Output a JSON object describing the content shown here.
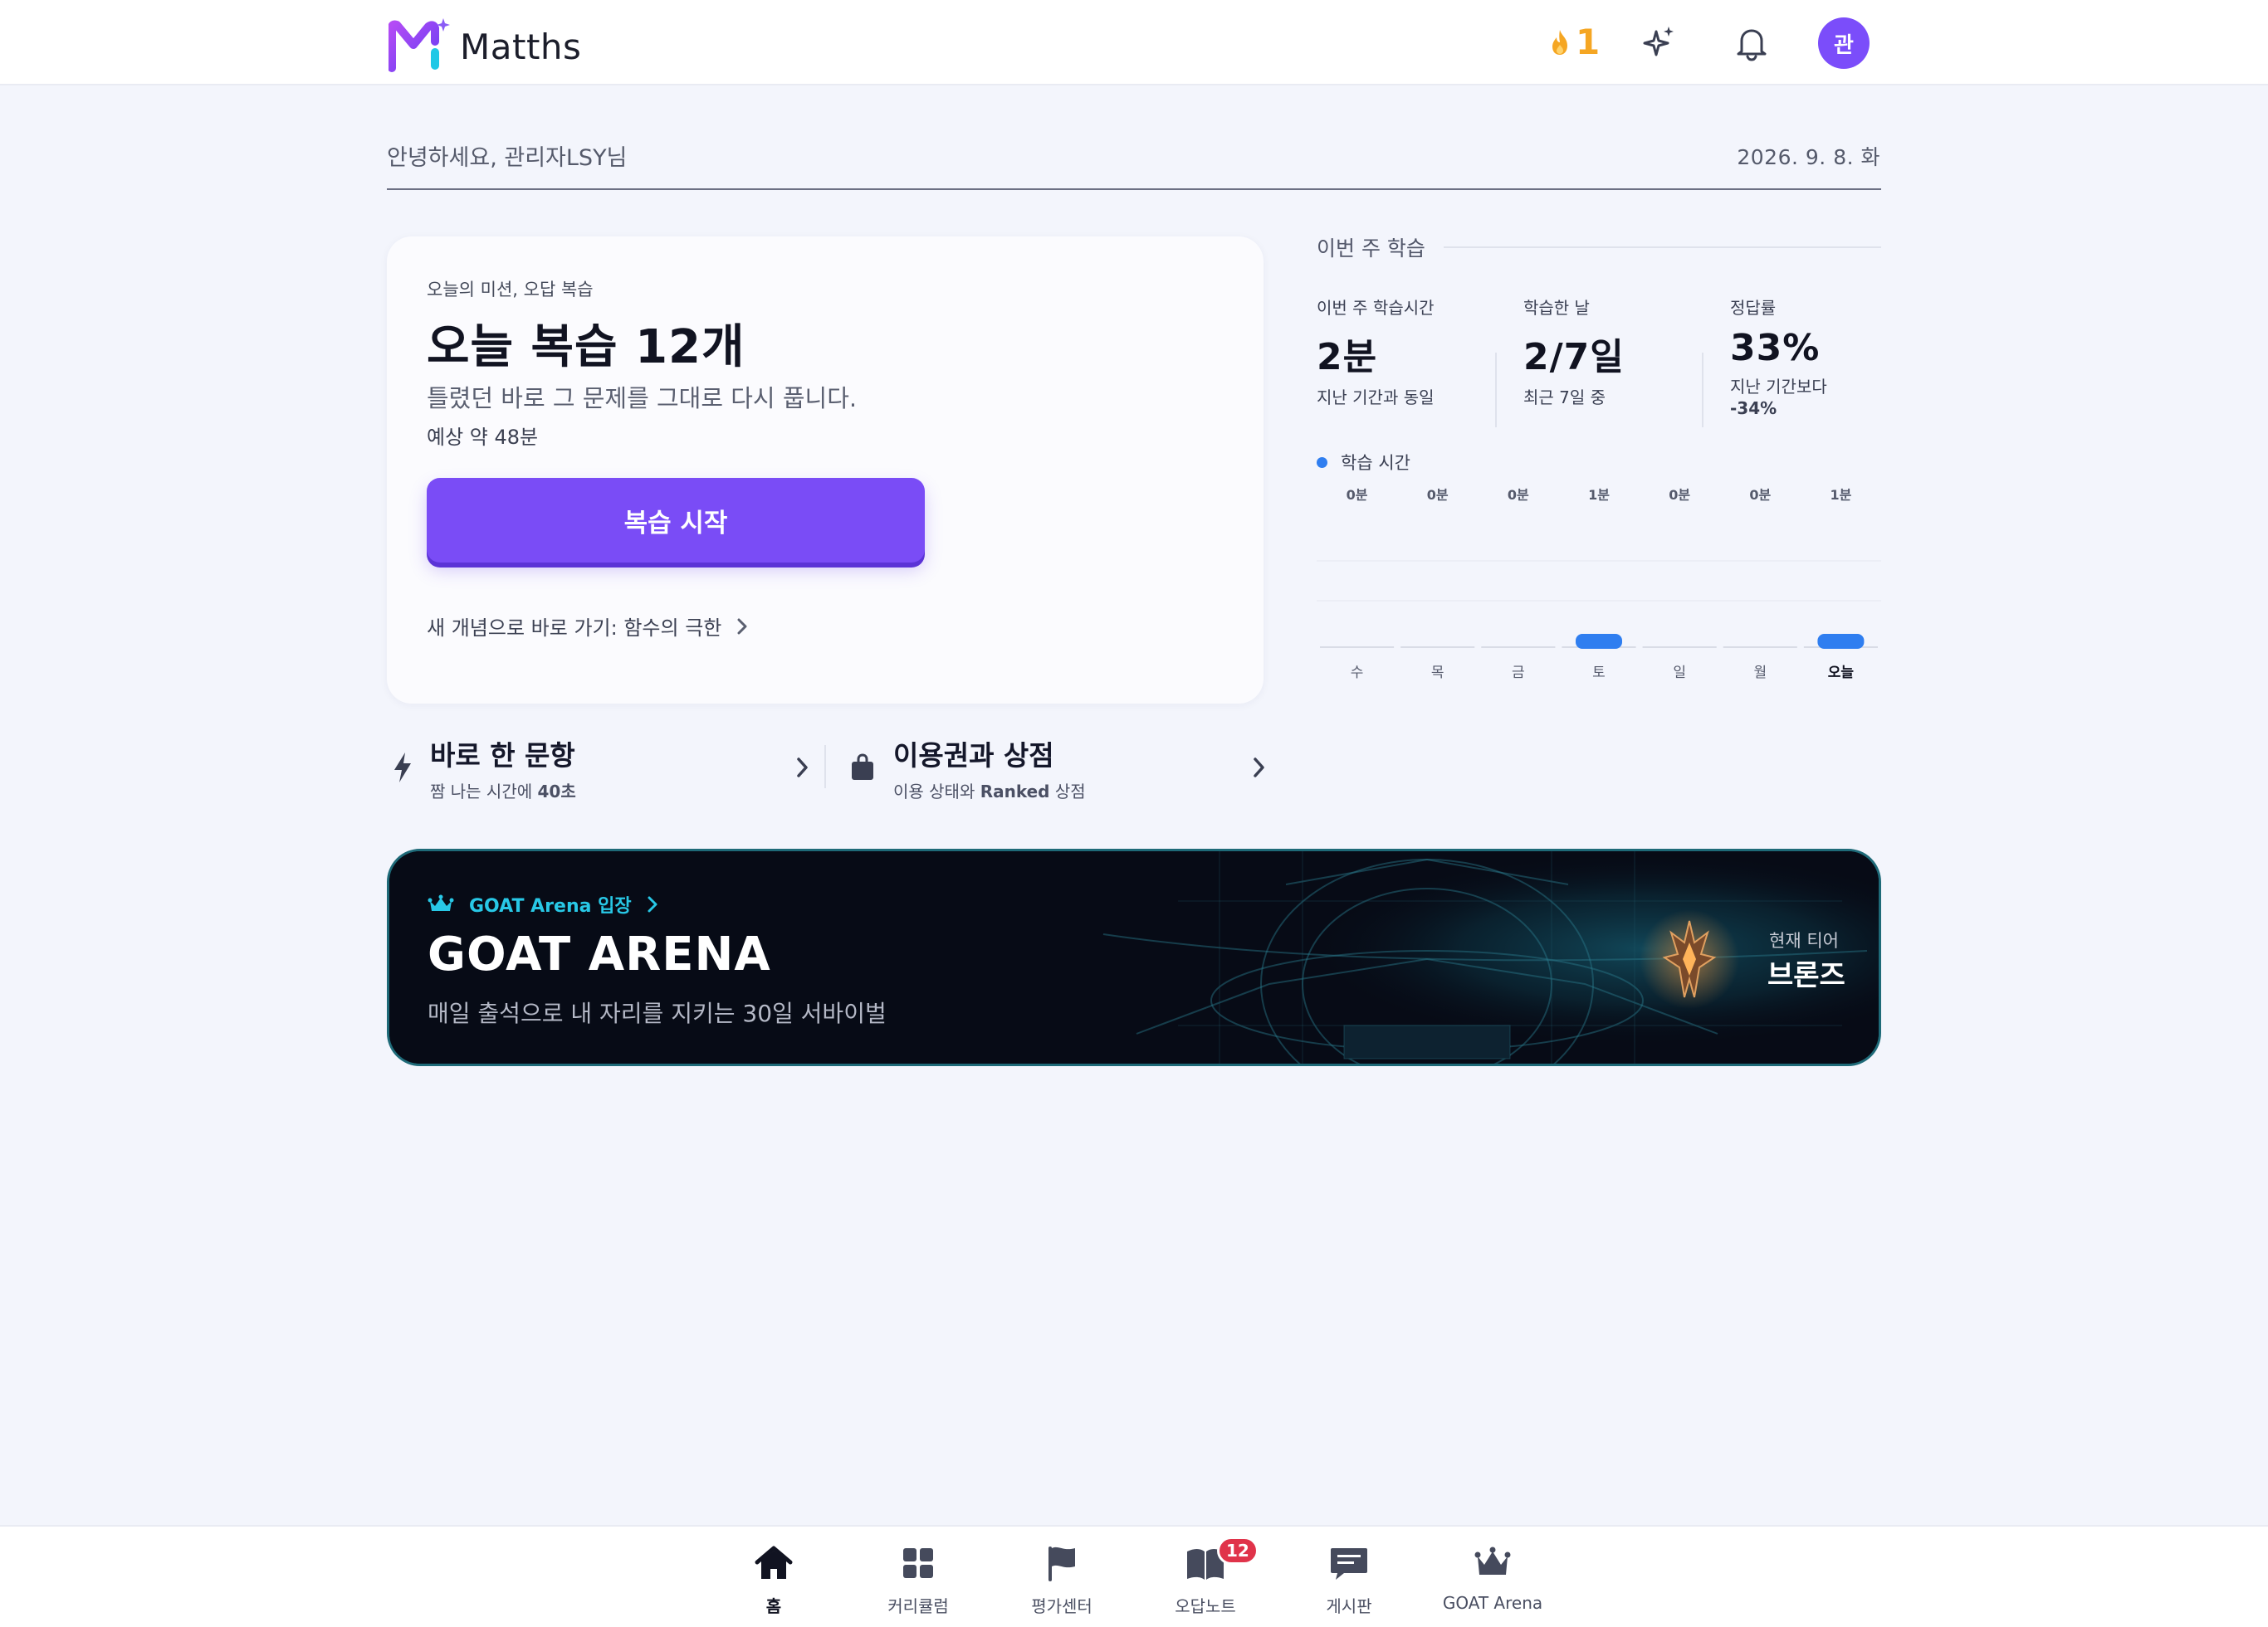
{
  "app": {
    "name": "Matths"
  },
  "topbar": {
    "streak_count": "1",
    "avatar_initial": "관",
    "icons": [
      "flame-icon",
      "sparkle-icon",
      "bell-icon"
    ]
  },
  "greeting": {
    "text": "안녕하세요, 관리자LSY님",
    "date": "2026. 9. 8. 화"
  },
  "mission": {
    "kicker": "오늘의 미션, 오답 복습",
    "title": "오늘 복습 12개",
    "description": "틀렸던 바로 그 문제를 그대로 다시 풉니다.",
    "estimate": "예상 약 48분",
    "button_label": "복습 시작",
    "concept_link": "새 개념으로 바로 가기: 함수의 극한"
  },
  "quick_links": [
    {
      "title": "바로 한 문항",
      "sub_prefix": "짬 나는 시간에 ",
      "sub_bold": "40초",
      "sub_suffix": "",
      "icon": "lightning-icon"
    },
    {
      "title": "이용권과 상점",
      "sub_prefix": "이용 상태와 ",
      "sub_bold": "Ranked",
      "sub_suffix": " 상점",
      "icon": "bag-icon"
    }
  ],
  "weekly": {
    "heading": "이번 주 학습",
    "stats": [
      {
        "label": "이번 주 학습시간",
        "value": "2분",
        "sub": "지난 기간과 동일",
        "sub2": ""
      },
      {
        "label": "학습한 날",
        "value": "2/7일",
        "sub": "최근 7일 중",
        "sub2": ""
      },
      {
        "label": "정답률",
        "value": "33%",
        "sub": "지난 기간보다",
        "sub2": "-34%"
      }
    ],
    "legend": "학습 시간",
    "accent_color": "#2f7ef0"
  },
  "chart_data": {
    "type": "bar",
    "categories": [
      "수",
      "목",
      "금",
      "토",
      "일",
      "월",
      "오늘"
    ],
    "values": [
      0,
      0,
      0,
      1,
      0,
      0,
      1
    ],
    "value_labels": [
      "0분",
      "0분",
      "0분",
      "1분",
      "0분",
      "0분",
      "1분"
    ],
    "series": [
      {
        "name": "학습 시간",
        "values": [
          0,
          0,
          0,
          1,
          0,
          0,
          1
        ]
      }
    ],
    "ylim": [
      0,
      10
    ],
    "grid": true,
    "legend_position": "top-left"
  },
  "arena": {
    "kicker": "GOAT Arena 입장",
    "title": "GOAT ARENA",
    "subtitle": "매일 출석으로 내 자리를 지키는 30일 서바이벌",
    "tier_label": "현재 티어",
    "tier": "브론즈",
    "accent_color": "#28c8e6"
  },
  "bottom_nav": {
    "items": [
      {
        "label": "홈",
        "icon": "home-icon",
        "active": true
      },
      {
        "label": "커리큘럼",
        "icon": "grid-icon",
        "active": false
      },
      {
        "label": "평가센터",
        "icon": "flag-icon",
        "active": false
      },
      {
        "label": "오답노트",
        "icon": "book-icon",
        "active": false,
        "badge": "12"
      },
      {
        "label": "게시판",
        "icon": "chat-icon",
        "active": false
      },
      {
        "label": "GOAT Arena",
        "icon": "crown-icon",
        "active": false
      }
    ]
  }
}
